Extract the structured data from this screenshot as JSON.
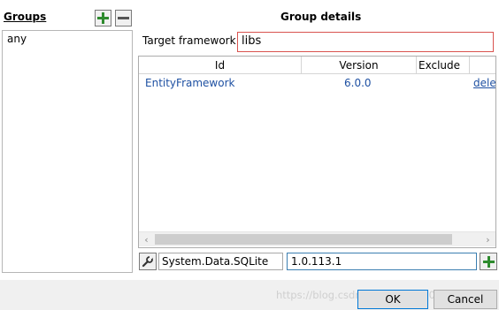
{
  "groups": {
    "title": "Groups",
    "items": [
      "any"
    ]
  },
  "details": {
    "title": "Group details",
    "target_framework_label": "Target framework",
    "target_framework_value": "libs"
  },
  "grid": {
    "columns": [
      "Id",
      "Version",
      "Exclude"
    ],
    "rows": [
      {
        "id": "EntityFramework",
        "version": "6.0.0",
        "action": "dele"
      }
    ]
  },
  "package_entry": {
    "name": "System.Data.SQLite",
    "version": "1.0.113.1"
  },
  "buttons": {
    "ok": "OK",
    "cancel": "Cancel"
  },
  "watermark": "https://blog.csdn.net/qq_45260783",
  "colors": {
    "accent": "#1e50a2",
    "error_border": "#d9534f",
    "add_icon": "#2e8b2e"
  }
}
